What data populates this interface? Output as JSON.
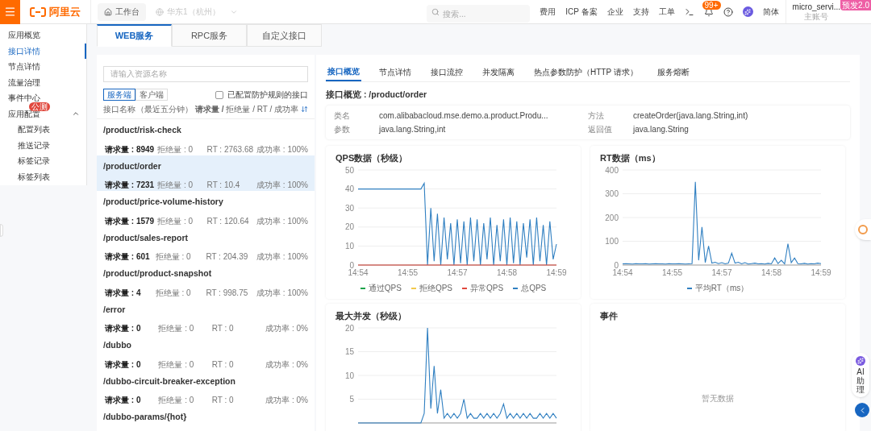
{
  "top_bar": {
    "logo": "阿里云",
    "workbench": "工作台",
    "region": "华东1（杭州）",
    "search": {
      "placeholder": "搜索..."
    },
    "links": [
      "费用",
      "ICP 备案",
      "企业",
      "支持",
      "工单"
    ],
    "notification_badge": "99+",
    "language": "简体",
    "account": {
      "name": "micro_servi...",
      "role": "主账号"
    },
    "env_badge": "预发2.0"
  },
  "sidebar": {
    "items": [
      {
        "label": "应用概览",
        "selected": false
      },
      {
        "label": "接口详情",
        "selected": true
      },
      {
        "label": "节点详情",
        "selected": false
      },
      {
        "label": "流量治理",
        "selected": false
      },
      {
        "label": "事件中心",
        "selected": false
      },
      {
        "label": "应用配置",
        "selected": false,
        "badge": "公测",
        "expanded": true,
        "children": [
          {
            "label": "配置列表",
            "selected": false
          },
          {
            "label": "推送记录",
            "selected": false
          },
          {
            "label": "标签记录",
            "selected": false
          },
          {
            "label": "标签列表",
            "selected": false
          }
        ]
      }
    ]
  },
  "service_tabs": [
    {
      "label": "WEB服务",
      "selected": true
    },
    {
      "label": "RPC服务",
      "selected": false
    },
    {
      "label": "自定义接口",
      "selected": false
    }
  ],
  "resource_list": {
    "search": {
      "placeholder": "请输入资源名称"
    },
    "sides": [
      {
        "label": "服务端",
        "selected": true
      },
      {
        "label": "客户端",
        "selected": false
      }
    ],
    "filter": {
      "label": "已配置防护规则的接口",
      "checked": false
    },
    "header": {
      "name": "接口名称",
      "metrics": "（最近五分钟） **请求量 /** 拒绝量 / RT / 成功率"
    },
    "rows": [
      {
        "name": "/product/risk-check",
        "selected": false,
        "stats": [
          "请求量 : 8949",
          "拒绝量 : 0",
          "RT : 2763.68",
          "成功率 : 100%"
        ]
      },
      {
        "name": "/product/order",
        "selected": true,
        "stats": [
          "请求量 : 7231",
          "拒绝量 : 0",
          "RT : 10.4",
          "成功率 : 100%"
        ]
      },
      {
        "name": "/product/price-volume-history",
        "selected": false,
        "stats": [
          "请求量 : 1579",
          "拒绝量 : 0",
          "RT : 120.64",
          "成功率 : 100%"
        ]
      },
      {
        "name": "/product/sales-report",
        "selected": false,
        "stats": [
          "请求量 : 601",
          "拒绝量 : 0",
          "RT : 204.39",
          "成功率 : 100%"
        ]
      },
      {
        "name": "/product/product-snapshot",
        "selected": false,
        "stats": [
          "请求量 : 4",
          "拒绝量 : 0",
          "RT : 998.75",
          "成功率 : 100%"
        ]
      },
      {
        "name": "/error",
        "selected": false,
        "stats": [
          "请求量 : 0",
          "拒绝量 : 0",
          "RT : 0",
          "成功率 : 0%"
        ]
      },
      {
        "name": "/dubbo",
        "selected": false,
        "stats": [
          "请求量 : 0",
          "拒绝量 : 0",
          "RT : 0",
          "成功率 : 0%"
        ]
      },
      {
        "name": "/dubbo-circuit-breaker-exception",
        "selected": false,
        "stats": [
          "请求量 : 0",
          "拒绝量 : 0",
          "RT : 0",
          "成功率 : 0%"
        ]
      },
      {
        "name": "/dubbo-params/{hot}",
        "selected": false
      }
    ]
  },
  "detail": {
    "tabs": [
      {
        "label": "接口概览",
        "selected": true
      },
      {
        "label": "节点详情",
        "selected": false
      },
      {
        "label": "接口流控",
        "selected": false
      },
      {
        "label": "并发隔离",
        "selected": false
      },
      {
        "label": "热点参数防护（HTTP 请求）",
        "selected": false
      },
      {
        "label": "服务熔断",
        "selected": false
      }
    ],
    "heading": "接口概览 : /product/order",
    "info": [
      {
        "label": "类名",
        "value": "com.alibabacloud.mse.demo.a.product.Produ..."
      },
      {
        "label": "方法",
        "value": "createOrder(java.lang.String,int)"
      },
      {
        "label": "参数",
        "value": "java.lang.String,int"
      },
      {
        "label": "返回值",
        "value": "java.lang.String"
      }
    ],
    "qps_card": {
      "chart_data": {
        "type": "line",
        "title": "QPS数据（秒级）",
        "categories": [
          "14:54",
          null,
          null,
          null,
          null,
          null,
          null,
          null,
          null,
          null,
          null,
          null,
          null,
          null,
          null,
          "14:55",
          null,
          null,
          null,
          null,
          null,
          null,
          null,
          null,
          null,
          null,
          null,
          null,
          null,
          null,
          "14:57",
          null,
          null,
          null,
          null,
          null,
          null,
          null,
          null,
          null,
          null,
          null,
          null,
          null,
          null,
          "14:58",
          null,
          null,
          null,
          null,
          null,
          null,
          null,
          null,
          null,
          null,
          null,
          null,
          null,
          null,
          "14:59"
        ],
        "ylim": [
          0,
          50
        ],
        "yticks": [
          0,
          10,
          20,
          30,
          40,
          50
        ],
        "grid": true,
        "series": [
          {
            "name": "通过QPS",
            "color": "#1aa34a",
            "values": [
              null,
              null,
              null,
              null,
              null,
              null,
              null,
              null,
              null,
              null,
              null,
              null,
              null,
              null,
              null,
              null,
              null,
              null,
              null,
              null,
              null,
              null,
              null,
              null,
              null,
              null,
              null,
              null,
              null,
              null,
              null,
              null,
              null,
              null,
              null,
              null,
              null,
              null,
              null,
              null,
              null,
              null,
              null,
              null,
              null,
              null,
              null,
              null,
              null,
              null,
              null,
              null,
              null,
              null,
              null,
              null,
              null,
              null,
              null,
              null,
              null
            ]
          },
          {
            "name": "拒绝QPS",
            "color": "#f2c94c",
            "values": [
              null,
              null,
              null,
              null,
              null,
              null,
              null,
              null,
              null,
              null,
              null,
              null,
              null,
              null,
              null,
              null,
              null,
              null,
              null,
              null,
              null,
              null,
              null,
              null,
              null,
              null,
              null,
              null,
              null,
              null,
              null,
              null,
              null,
              null,
              null,
              null,
              null,
              null,
              null,
              null,
              null,
              null,
              null,
              null,
              null,
              null,
              null,
              null,
              null,
              null,
              null,
              null,
              null,
              null,
              null,
              null,
              null,
              null,
              null,
              null,
              null
            ]
          },
          {
            "name": "异常QPS",
            "color": "#e0483d",
            "values": [
              0,
              0,
              0,
              0,
              0,
              0,
              0,
              0,
              0,
              0,
              0,
              0,
              0,
              0,
              0,
              0,
              0,
              0,
              0,
              0,
              0,
              0,
              0,
              0,
              0,
              0,
              0,
              0,
              0,
              0,
              0,
              0,
              0,
              0,
              0,
              0,
              0,
              0,
              0,
              0,
              0,
              0,
              0,
              0,
              0,
              0,
              0,
              0,
              0,
              0,
              0,
              0,
              0,
              0,
              0,
              0,
              0,
              0,
              0,
              0,
              0
            ]
          },
          {
            "name": "总QPS",
            "color": "#2f7fc1",
            "values": [
              40,
              40,
              40,
              40,
              40,
              40,
              40,
              40,
              40,
              40,
              40,
              40,
              40,
              40,
              40,
              40,
              40,
              40,
              40,
              40,
              43,
              0,
              30,
              2,
              27,
              0,
              25,
              3,
              22,
              0,
              24,
              1,
              23,
              0,
              25,
              2,
              24,
              0,
              22,
              3,
              25,
              0,
              21,
              2,
              24,
              0,
              25,
              1,
              23,
              0,
              22,
              4,
              24,
              0,
              25,
              2,
              21,
              0,
              23,
              3,
              11
            ]
          }
        ]
      }
    },
    "rt_card": {
      "chart_data": {
        "type": "line",
        "title": "RT数据（ms）",
        "categories": [
          "14:54",
          null,
          null,
          null,
          null,
          null,
          null,
          null,
          null,
          null,
          null,
          null,
          null,
          null,
          null,
          "14:55",
          null,
          null,
          null,
          null,
          null,
          null,
          null,
          null,
          null,
          null,
          null,
          null,
          null,
          null,
          "14:57",
          null,
          null,
          null,
          null,
          null,
          null,
          null,
          null,
          null,
          null,
          null,
          null,
          null,
          null,
          "14:58",
          null,
          null,
          null,
          null,
          null,
          null,
          null,
          null,
          null,
          null,
          null,
          null,
          null,
          null,
          "14:59"
        ],
        "ylim": [
          0,
          400
        ],
        "yticks": [
          0,
          100,
          200,
          300,
          400
        ],
        "grid": true,
        "series": [
          {
            "name": "平均RT（ms）",
            "color": "#2f7fc1",
            "values": [
              5,
              6,
              5,
              4,
              6,
              5,
              5,
              6,
              4,
              5,
              6,
              5,
              5,
              4,
              6,
              5,
              5,
              6,
              5,
              4,
              5,
              6,
              350,
              20,
              160,
              10,
              80,
              8,
              12,
              6,
              10,
              5,
              8,
              50,
              8,
              12,
              5,
              10,
              4,
              6,
              8,
              5,
              6,
              4,
              7,
              5,
              30,
              6,
              20,
              5,
              90,
              10,
              30,
              6,
              5,
              7,
              4,
              6,
              5,
              8,
              6
            ]
          }
        ]
      }
    },
    "concurrency_card": {
      "chart_data": {
        "type": "line",
        "title": "最大并发（秒级）",
        "categories": [
          null,
          null,
          null,
          null,
          null,
          null,
          null,
          null,
          null,
          null,
          null,
          null,
          null,
          null,
          null,
          null,
          null,
          null,
          null,
          null,
          null,
          null,
          null,
          null,
          null,
          null,
          null,
          null,
          null,
          null,
          null,
          null,
          null,
          null,
          null,
          null,
          null,
          null,
          null,
          null,
          null,
          null,
          null,
          null,
          null,
          null,
          null,
          null,
          null,
          null,
          null,
          null,
          null,
          null,
          null,
          null,
          null,
          null,
          null,
          null,
          null
        ],
        "ylim": [
          0,
          20
        ],
        "yticks": [
          5,
          10,
          15,
          20
        ],
        "grid": true,
        "series": [
          {
            "color": "#2f7fc1",
            "values": [
              0,
              0,
              0,
              0,
              0,
              0,
              0,
              0,
              0,
              0,
              0,
              0,
              0,
              0,
              0,
              0,
              0,
              0,
              0,
              0,
              2,
              20,
              3,
              12,
              2,
              7,
              1,
              2,
              1,
              2,
              1,
              2,
              5,
              1,
              2,
              1,
              1,
              2,
              1,
              2,
              1,
              2,
              1,
              2,
              4,
              1,
              2,
              1,
              2,
              1,
              2,
              1,
              2,
              1,
              1,
              2,
              1,
              2,
              1,
              2,
              1
            ]
          }
        ]
      }
    },
    "events_card": {
      "title": "事件",
      "empty": "暂无数据"
    }
  },
  "assistant": {
    "label": "AI助理"
  }
}
